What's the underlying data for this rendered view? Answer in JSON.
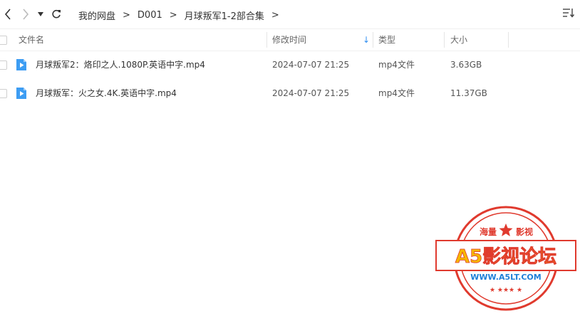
{
  "breadcrumb": [
    "我的网盘",
    "D001",
    "月球叛军1-2部合集"
  ],
  "columns": {
    "name": "文件名",
    "modified": "修改时间",
    "type": "类型",
    "size": "大小"
  },
  "files": [
    {
      "name": "月球叛军2：烙印之人.1080P.英语中字.mp4",
      "modified": "2024-07-07 21:25",
      "type": "mp4文件",
      "size": "3.63GB"
    },
    {
      "name": "月球叛军：火之女.4K.英语中字.mp4",
      "modified": "2024-07-07 21:25",
      "type": "mp4文件",
      "size": "11.37GB"
    }
  ],
  "watermark": {
    "top_text": "海量",
    "right_text": "影视",
    "banner": "A5影视论坛",
    "url": "WWW.A5LT.COM"
  },
  "colors": {
    "accent": "#2e8ef0",
    "stamp_red": "#e03a2e",
    "banner_yellow": "#f5b800"
  }
}
